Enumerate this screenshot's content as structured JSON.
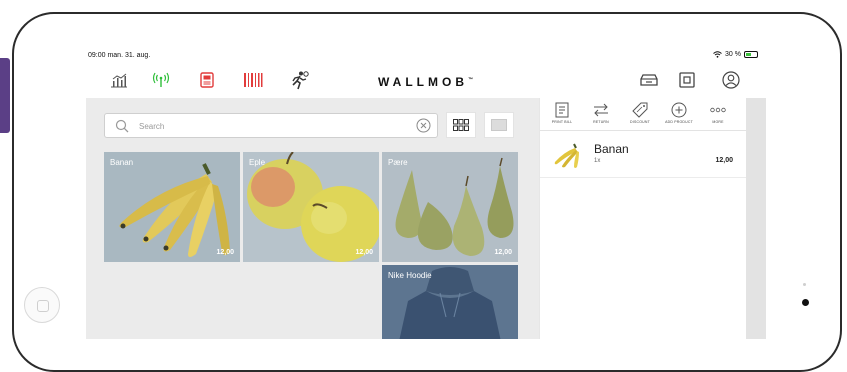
{
  "status": {
    "time_date": "09:00  man. 31. aug.",
    "battery": "30 %"
  },
  "app": {
    "logo": "WALLMOB",
    "logo_mark": "™"
  },
  "toolbar": {
    "left_icons": [
      "stats-icon",
      "wireless-icon",
      "receipt-printer-icon",
      "barcode-icon",
      "running-person-icon"
    ],
    "right_icons": [
      "cash-drawer-icon",
      "reader-icon",
      "user-icon"
    ]
  },
  "search": {
    "placeholder": "Search"
  },
  "products": [
    {
      "name": "Banan",
      "price": "12,00"
    },
    {
      "name": "Eple",
      "price": "12,00"
    },
    {
      "name": "Pære",
      "price": "12,00"
    },
    {
      "name": "Nike Hoodie",
      "price": ""
    }
  ],
  "actions": [
    {
      "label": "PRINT BILL"
    },
    {
      "label": "RETURN"
    },
    {
      "label": "DISCOUNT"
    },
    {
      "label": "ADD PRODUCT"
    },
    {
      "label": "MORE"
    }
  ],
  "cart": {
    "items": [
      {
        "name": "Banan",
        "qty": "1x",
        "price": "12,00"
      }
    ]
  },
  "colors": {
    "accent_green": "#2fbf3a",
    "accent_red": "#e23c3c",
    "panel_gray": "#ebebeb",
    "frame_purple": "#5b3f86"
  }
}
